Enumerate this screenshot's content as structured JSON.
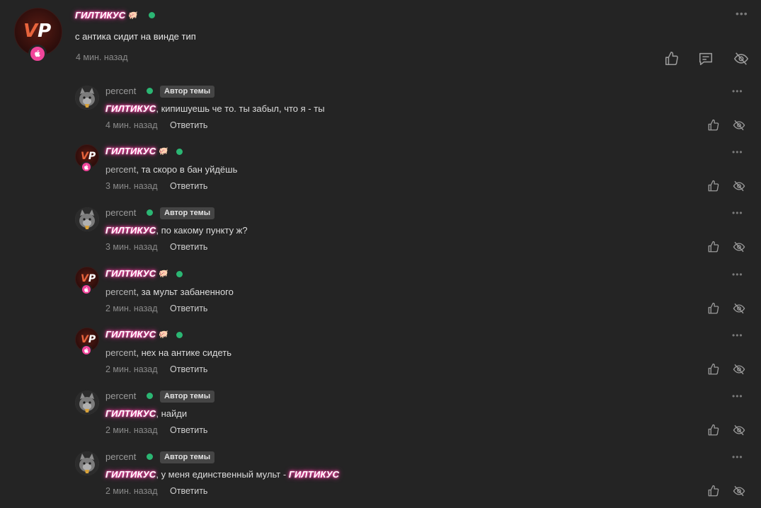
{
  "main_post": {
    "author": "ГИЛТИКУС",
    "pig": "🐖",
    "text": "с антика сидит на винде тип",
    "time": "4 мин. назад",
    "avatar_text_v": "V",
    "avatar_text_p": "P",
    "more": "•••"
  },
  "comments": [
    {
      "author": "percent",
      "is_topic_author": true,
      "badge": "Автор темы",
      "mention": "ГИЛТИКУС",
      "text": ", кипишуешь че то. ты забыл, что я - ты",
      "time": "4 мин. назад",
      "reply": "Ответить"
    },
    {
      "author": "ГИЛТИКУС",
      "is_topic_author": false,
      "mention": "percent",
      "text": ", та скоро в бан уйдёшь",
      "time": "3 мин. назад",
      "reply": "Ответить"
    },
    {
      "author": "percent",
      "is_topic_author": true,
      "badge": "Автор темы",
      "mention": "ГИЛТИКУС",
      "text": ", по какому пункту ж?",
      "time": "3 мин. назад",
      "reply": "Ответить"
    },
    {
      "author": "ГИЛТИКУС",
      "is_topic_author": false,
      "mention": "percent",
      "text": ", за мульт забаненного",
      "time": "2 мин. назад",
      "reply": "Ответить"
    },
    {
      "author": "ГИЛТИКУС",
      "is_topic_author": false,
      "mention": "percent",
      "text": ", нех на антике сидеть",
      "time": "2 мин. назад",
      "reply": "Ответить"
    },
    {
      "author": "percent",
      "is_topic_author": true,
      "badge": "Автор темы",
      "mention": "ГИЛТИКУС",
      "text": ", найди",
      "time": "2 мин. назад",
      "reply": "Ответить"
    },
    {
      "author": "percent",
      "is_topic_author": true,
      "badge": "Автор темы",
      "mention": "ГИЛТИКУС",
      "text": ", у меня единственный мульт - ",
      "mention2": "ГИЛТИКУС",
      "time": "2 мин. назад",
      "reply": "Ответить"
    }
  ],
  "icons": {
    "like": "thumbs-up-icon",
    "reply": "comment-icon",
    "hide": "eye-slash-icon",
    "more": "more-dots-icon",
    "badge": "apple-icon"
  },
  "colors": {
    "background": "#242424",
    "nick_glow": "#ff3fa4",
    "online": "#2bb673",
    "badge_bg": "#454545",
    "apple_badge": "#f0459a"
  }
}
